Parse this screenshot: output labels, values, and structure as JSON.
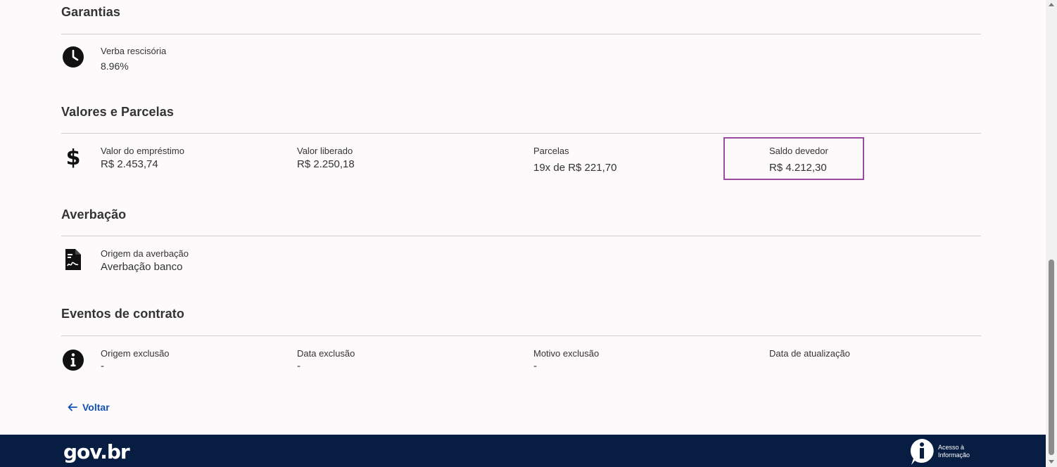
{
  "garantias": {
    "title": "Garantias",
    "verba_label": "Verba rescisória",
    "verba_value": "8.96%"
  },
  "valores": {
    "title": "Valores e Parcelas",
    "emprestimo_label": "Valor do empréstimo",
    "emprestimo_value": "R$ 2.453,74",
    "liberado_label": "Valor liberado",
    "liberado_value": "R$ 2.250,18",
    "parcelas_label": "Parcelas",
    "parcelas_value": "19x de R$ 221,70",
    "saldo_label": "Saldo devedor",
    "saldo_value": "R$ 4.212,30"
  },
  "averbacao": {
    "title": "Averbação",
    "origem_label": "Origem da averbação",
    "origem_value": "Averbação banco"
  },
  "eventos": {
    "title": "Eventos de contrato",
    "origem_label": "Origem exclusão",
    "origem_value": "-",
    "data_label": "Data exclusão",
    "data_value": "-",
    "motivo_label": "Motivo exclusão",
    "motivo_value": "-",
    "atualizacao_label": "Data de atualização"
  },
  "back_label": "Voltar",
  "footer": {
    "logo": "gov.br",
    "acesso_line1": "Acesso à",
    "acesso_line2": "Informação"
  },
  "icons": {
    "garantias": "clock-icon",
    "valores": "dollar-icon",
    "averbacao": "document-icon",
    "eventos": "info-icon",
    "back": "arrow-left-icon"
  },
  "colors": {
    "highlight_border": "#9b4a9f",
    "link": "#1351b4",
    "footer_bg": "#071d41"
  }
}
